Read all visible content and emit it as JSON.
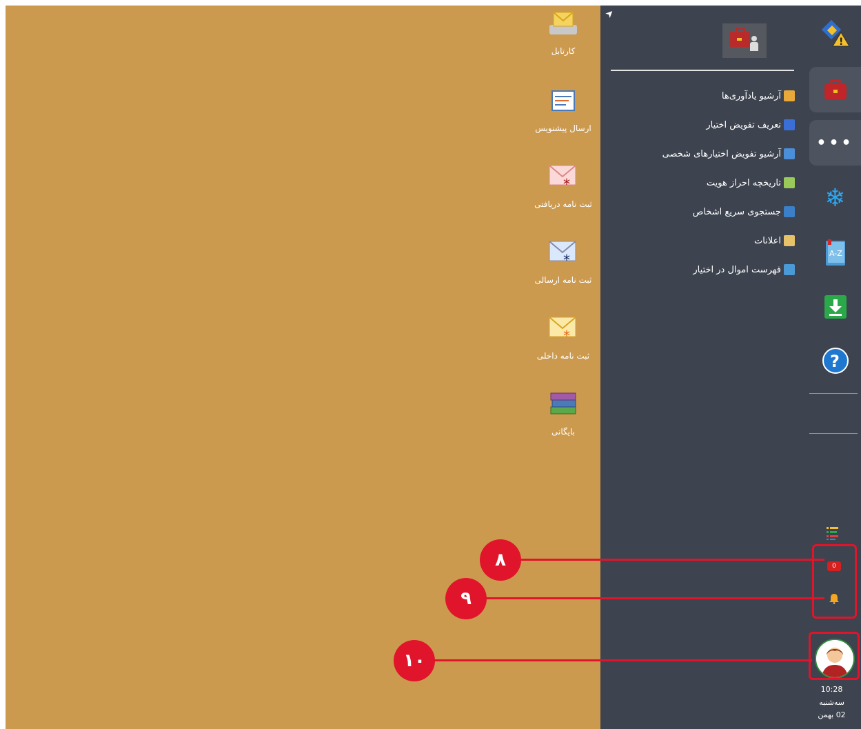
{
  "desktop": {
    "icons": [
      {
        "label": "کارتابل",
        "icon": "envelope-tray-icon"
      },
      {
        "label": "ارسال پیشنویس",
        "icon": "draft-send-icon"
      },
      {
        "label": "ثبت نامه دریافتی",
        "icon": "received-letter-icon"
      },
      {
        "label": "ثبت نامه ارسالی",
        "icon": "sent-letter-icon"
      },
      {
        "label": "ثبت نامه داخلی",
        "icon": "internal-letter-icon"
      },
      {
        "label": "بایگانی",
        "icon": "archive-books-icon"
      }
    ]
  },
  "panel": {
    "menu": [
      {
        "label": "آرشیو یادآوری‌ها",
        "icon": "reminder-archive-icon",
        "color": "#e8a83a"
      },
      {
        "label": "تعریف تفویض اختیار",
        "icon": "delegation-icon",
        "color": "#3a6fd8"
      },
      {
        "label": "آرشیو تفویض اختیارهای شخصی",
        "icon": "delegation-archive-icon",
        "color": "#4a8fd8"
      },
      {
        "label": "تاریخچه احراز هویت",
        "icon": "auth-history-icon",
        "color": "#9acb5a"
      },
      {
        "label": "جستجوی سریع اشخاص",
        "icon": "person-search-icon",
        "color": "#3a7fc8"
      },
      {
        "label": "اعلانات",
        "icon": "announcement-icon",
        "color": "#e8c26a"
      },
      {
        "label": "فهرست اموال در اختیار",
        "icon": "assets-list-icon",
        "color": "#4a9ad8"
      }
    ]
  },
  "rail": {
    "notification_count": "0",
    "time": "10:28",
    "weekday": "سه‌شنبه",
    "date": "02 بهمن"
  },
  "callouts": [
    "۸",
    "۹",
    "۱۰"
  ],
  "colors": {
    "desktop": "#cc9a4f",
    "panel": "#3d434f",
    "callout": "#e0142a"
  }
}
